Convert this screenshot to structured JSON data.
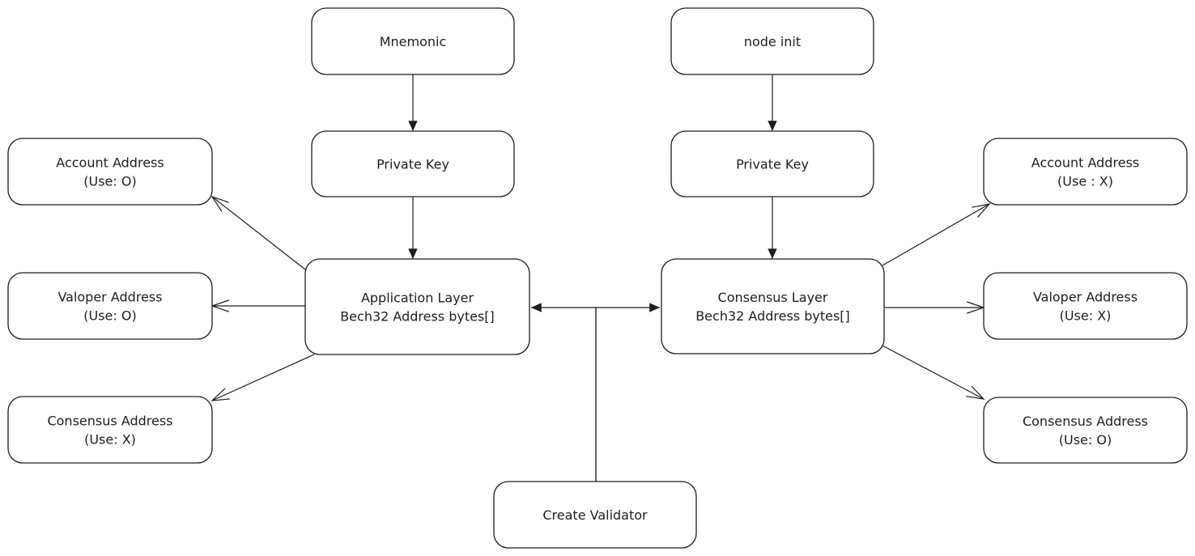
{
  "nodes": {
    "mnemonic": {
      "lines": [
        "Mnemonic"
      ]
    },
    "node_init": {
      "lines": [
        "node init"
      ]
    },
    "private_key_left": {
      "lines": [
        "Private Key"
      ]
    },
    "private_key_right": {
      "lines": [
        "Private Key"
      ]
    },
    "application_layer": {
      "lines": [
        "Application Layer",
        "Bech32 Address bytes[]"
      ]
    },
    "consensus_layer": {
      "lines": [
        "Consensus Layer",
        "Bech32 Address bytes[]"
      ]
    },
    "account_left": {
      "lines": [
        "Account Address",
        "(Use: O)"
      ]
    },
    "valoper_left": {
      "lines": [
        "Valoper Address",
        "(Use: O)"
      ]
    },
    "consensus_left": {
      "lines": [
        "Consensus Address",
        "(Use: X)"
      ]
    },
    "account_right": {
      "lines": [
        "Account Address",
        "(Use : X)"
      ]
    },
    "valoper_right": {
      "lines": [
        "Valoper Address",
        "(Use: X)"
      ]
    },
    "consensus_right": {
      "lines": [
        "Consensus Address",
        "(Use: O)"
      ]
    },
    "create_validator": {
      "lines": [
        "Create Validator"
      ]
    }
  },
  "edges": [
    {
      "from": "mnemonic",
      "to": "private_key_left",
      "head": "filled"
    },
    {
      "from": "private_key_left",
      "to": "application_layer",
      "head": "filled"
    },
    {
      "from": "node_init",
      "to": "private_key_right",
      "head": "filled"
    },
    {
      "from": "private_key_right",
      "to": "consensus_layer",
      "head": "filled"
    },
    {
      "from": "application_layer",
      "to": "account_left",
      "head": "open"
    },
    {
      "from": "application_layer",
      "to": "valoper_left",
      "head": "open"
    },
    {
      "from": "application_layer",
      "to": "consensus_left",
      "head": "open"
    },
    {
      "from": "consensus_layer",
      "to": "account_right",
      "head": "open"
    },
    {
      "from": "consensus_layer",
      "to": "valoper_right",
      "head": "open"
    },
    {
      "from": "consensus_layer",
      "to": "consensus_right",
      "head": "open"
    },
    {
      "from": "create_validator",
      "to": "application_layer",
      "head": "filled"
    },
    {
      "from": "create_validator",
      "to": "consensus_layer",
      "head": "filled"
    }
  ]
}
